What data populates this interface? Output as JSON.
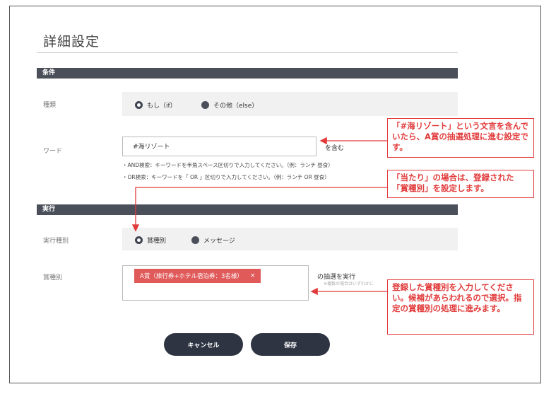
{
  "page": {
    "title": "詳細設定"
  },
  "conditions": {
    "header": "条件",
    "type_label": "種類",
    "type_options": [
      "もし（if）",
      "その他（else）"
    ],
    "word_label": "ワード",
    "word_value": "#海リゾート",
    "word_suffix": "を含む",
    "help_and": "・AND検索：キーワードを半角スペース区切りで入力してください。（例：ランチ 昼食）",
    "help_or": "・OR検索：キーワードを「 OR 」区切りで入力してください。（例：ランチ OR 昼食）"
  },
  "execution": {
    "header": "実行",
    "type_label": "実行種別",
    "type_options": [
      "賞種別",
      "メッセージ"
    ],
    "prize_label": "賞種別",
    "prize_tag": "A賞（旅行券+ホテル宿泊券：3名様）",
    "prize_tag_close": "×",
    "prize_suffix": "の抽選を実行",
    "prize_note": "※複数の場合はいずれかに"
  },
  "buttons": {
    "cancel": "キャンセル",
    "save": "保存"
  },
  "callouts": {
    "word": "「#海リゾート」という文言を含んでいたら、A賞の抽選処理に進む設定です。",
    "atari": "「当たり」の場合は、登録された「賞種別」を設定します。",
    "prize": "登録した賞種別を入力してください。候補があらわれるので選択。指定の賞種別の処理に進みます。"
  },
  "colors": {
    "accent": "#e23b3b",
    "bar": "#4a4f59",
    "button": "#2e3441",
    "tag": "#e05a5a"
  }
}
